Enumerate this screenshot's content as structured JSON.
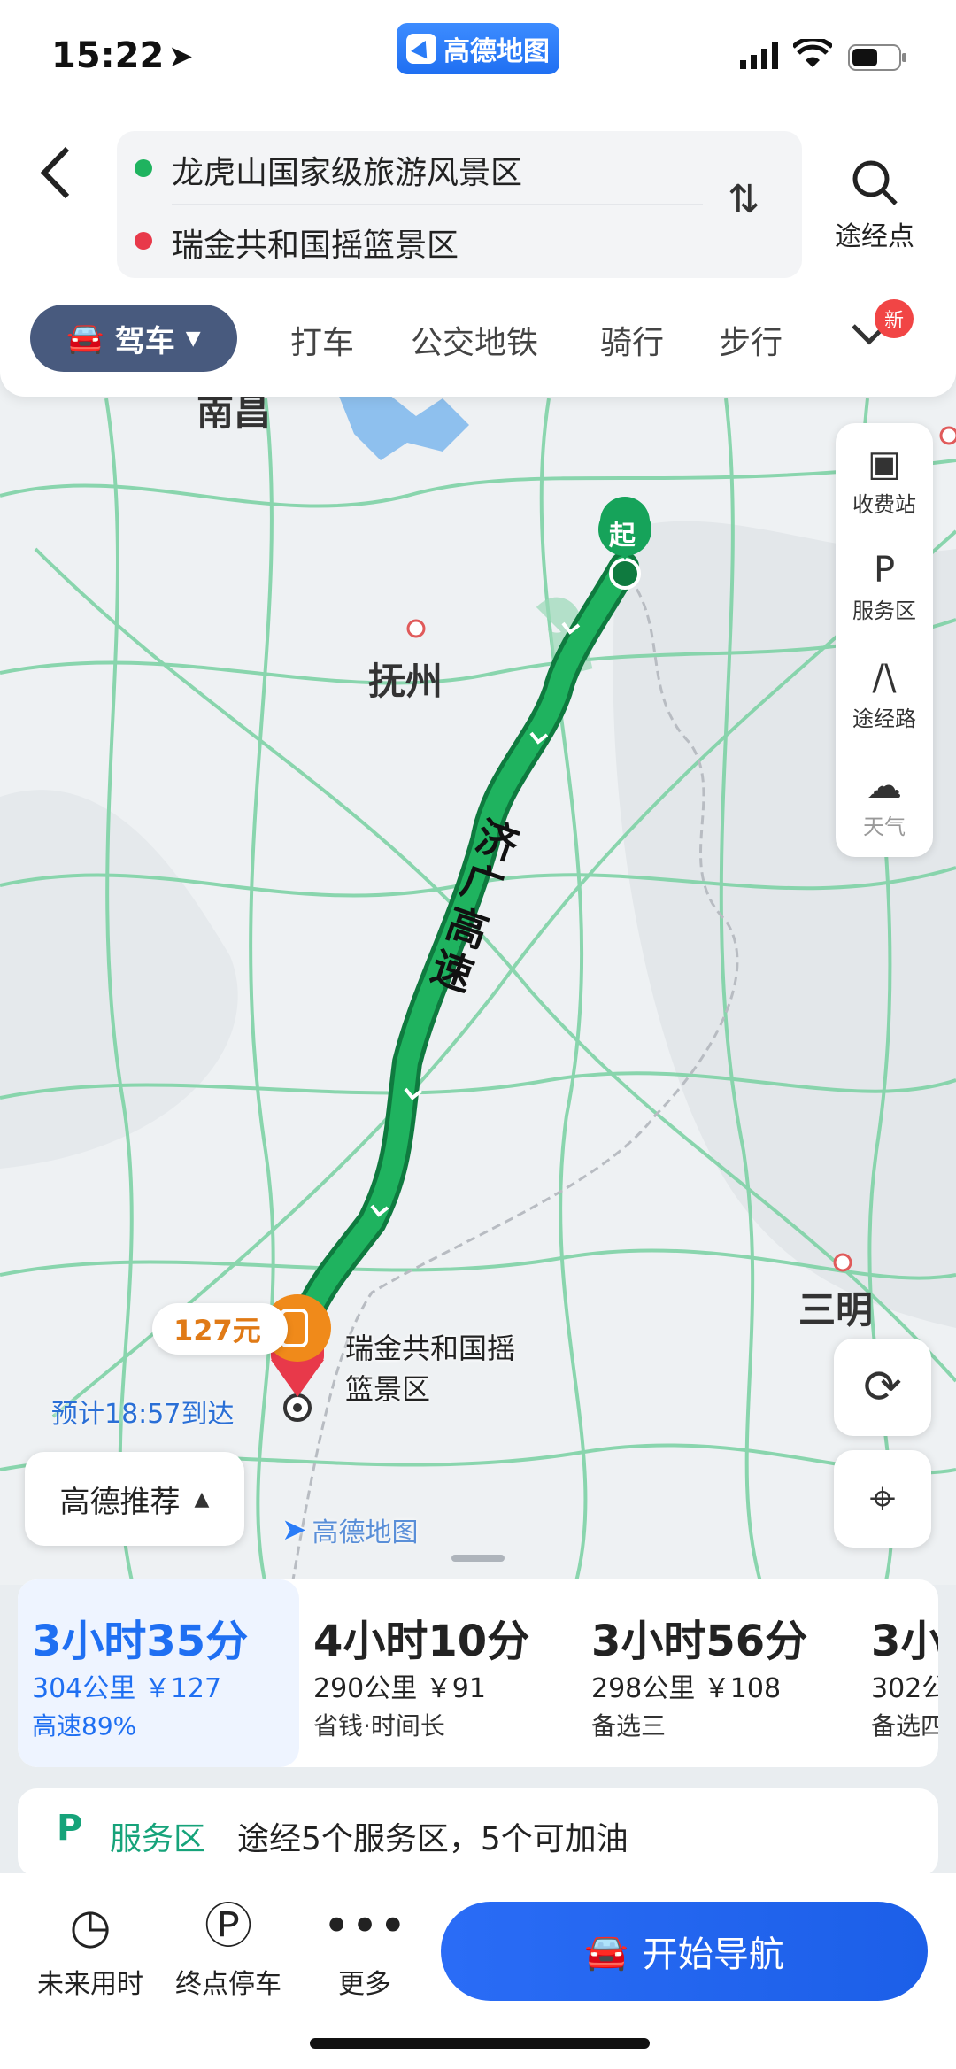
{
  "status": {
    "time": "15:22"
  },
  "app_badge": {
    "label": "高德地图"
  },
  "route": {
    "origin": "龙虎山国家级旅游风景区",
    "destination": "瑞金共和国摇篮景区",
    "waypoint_label": "途经点"
  },
  "modes": {
    "drive": "驾车",
    "taxi": "打车",
    "transit": "公交地铁",
    "bike": "骑行",
    "walk": "步行",
    "new_badge": "新"
  },
  "map_tools": {
    "toll": "收费站",
    "service": "服务区",
    "routes": "途经路",
    "weather": "天气"
  },
  "map": {
    "city_nanchang": "南昌",
    "city_fuzhou": "抚州",
    "city_sanming": "三明",
    "road_name": "济广高速",
    "start_marker": "起",
    "toll_price": "127元",
    "dest_label_line1": "瑞金共和国摇",
    "dest_label_line2": "篮景区",
    "eta": "预计18:57到达",
    "recommend": "高德推荐",
    "logo": "高德地图"
  },
  "route_options": [
    {
      "time": "3小时35分",
      "dist": "304公里 ￥127",
      "note": "高速89%",
      "selected": true
    },
    {
      "time": "4小时10分",
      "dist": "290公里 ￥91",
      "note": "省钱·时间长",
      "selected": false
    },
    {
      "time": "3小时56分",
      "dist": "298公里 ￥108",
      "note": "备选三",
      "selected": false
    },
    {
      "time": "3小",
      "dist": "302公",
      "note": "备选四",
      "selected": false
    }
  ],
  "service_strip": {
    "title": "服务区",
    "desc": "途经5个服务区，5个可加油"
  },
  "bottom_bar": {
    "future_time": "未来用时",
    "parking": "终点停车",
    "more": "更多",
    "start_nav": "开始导航"
  },
  "colors": {
    "accent_blue": "#1f6ff2",
    "route_green": "#16a35a",
    "toll_orange": "#f08a1a",
    "dest_red": "#e8394a"
  }
}
